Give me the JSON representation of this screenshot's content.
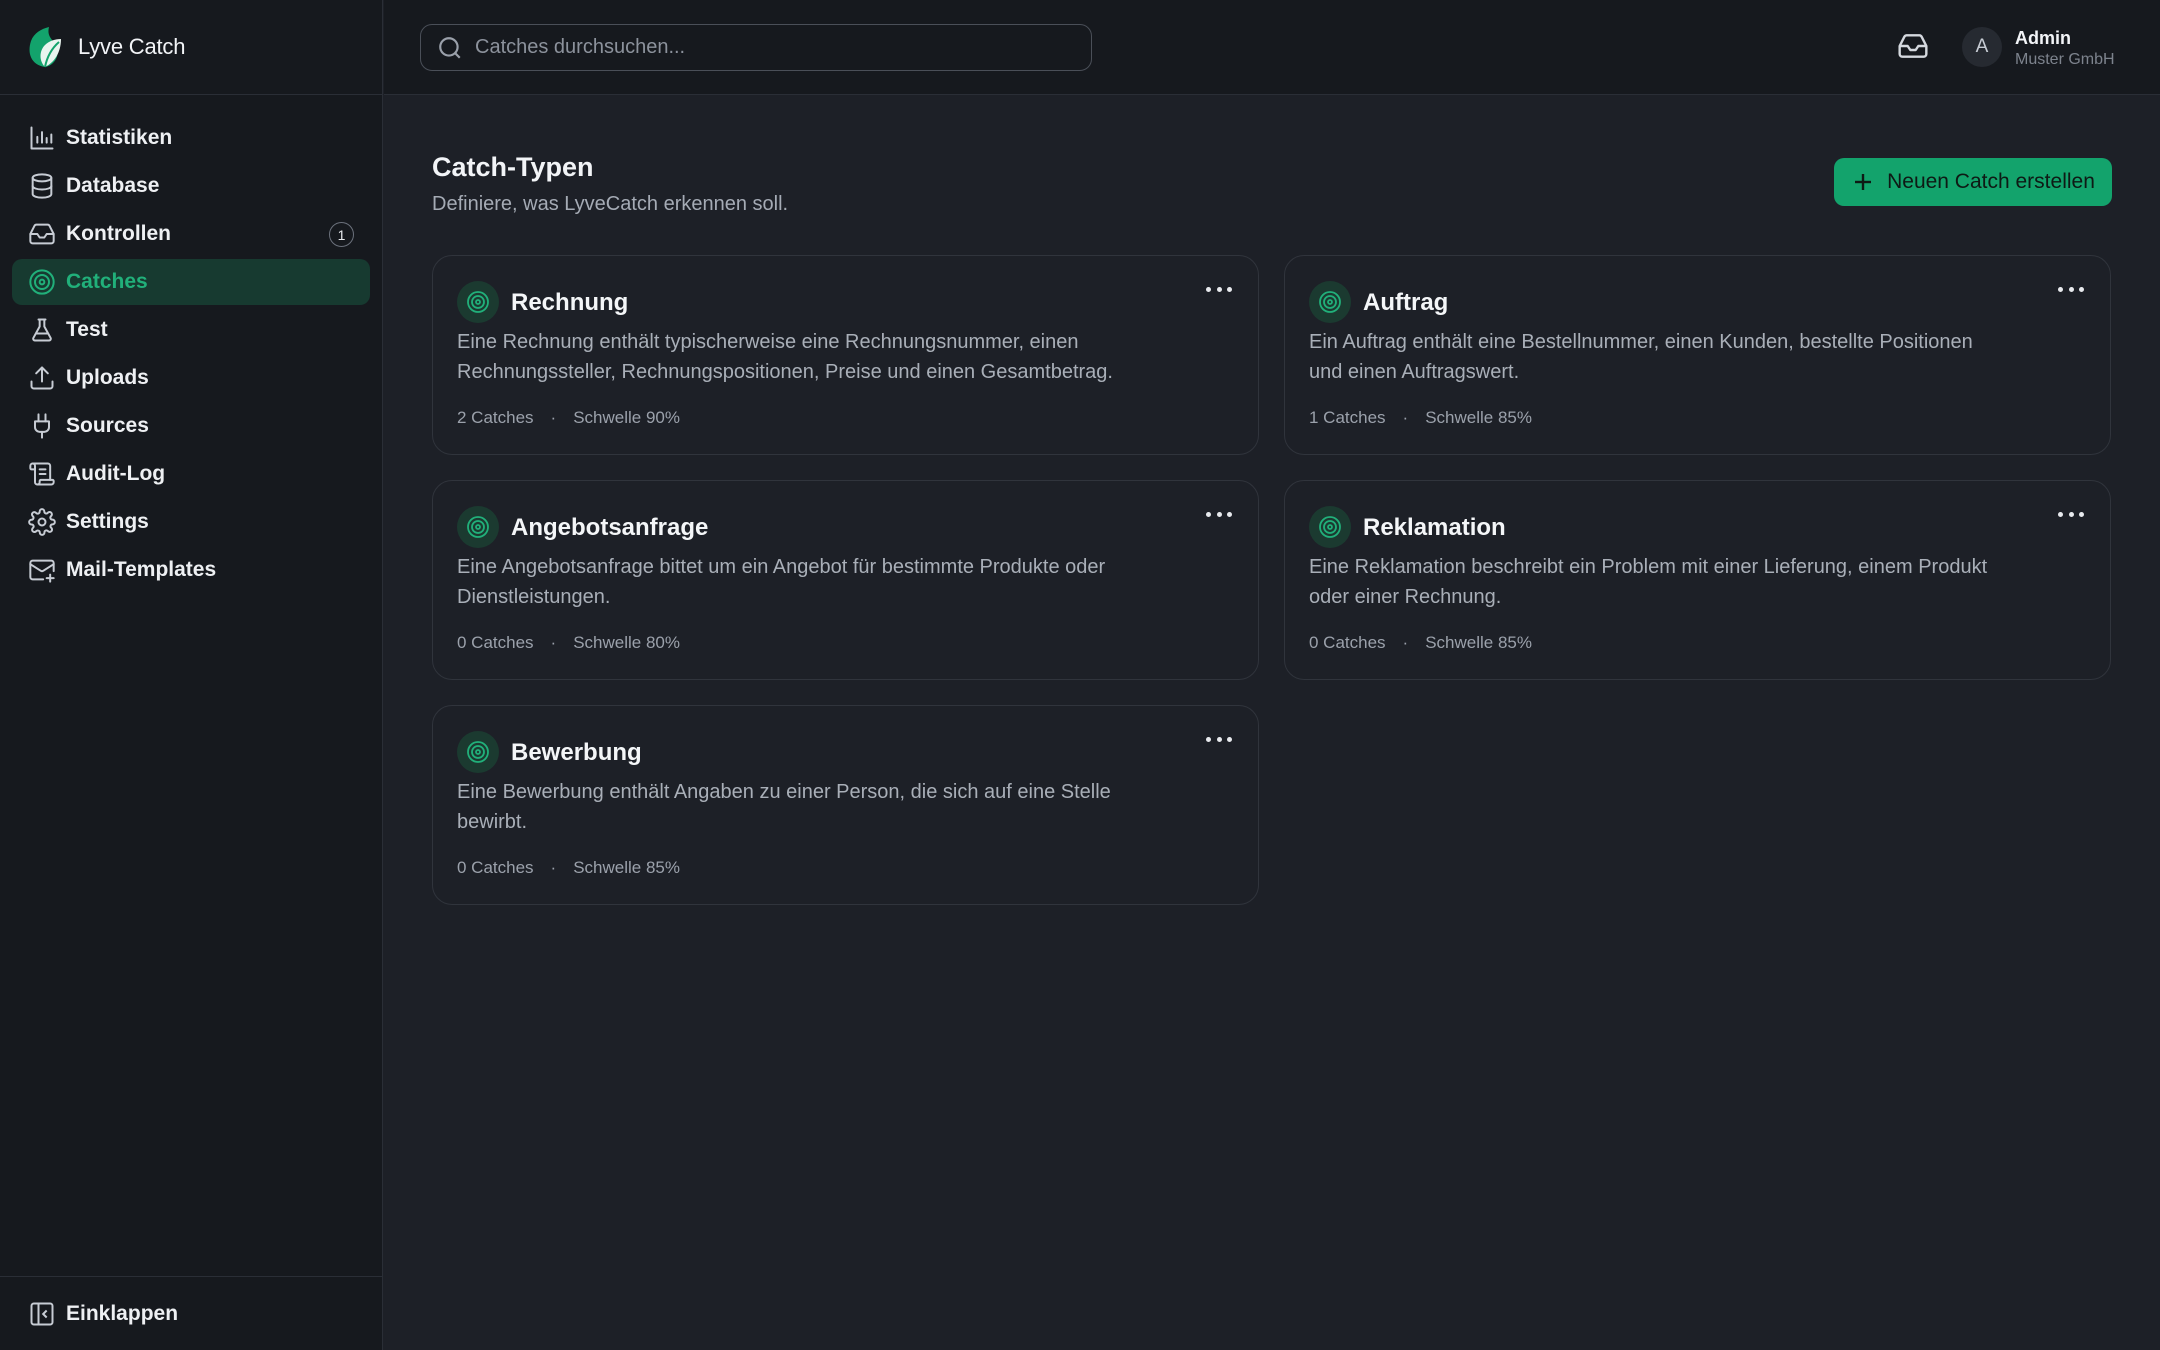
{
  "brand": {
    "name": "Lyve Catch"
  },
  "colors": {
    "accent": "#13a36c",
    "accent_text": "#21b07a",
    "sidebar_bg": "#16191e",
    "main_bg": "#1d2027"
  },
  "sidebar": {
    "items": [
      {
        "label": "Statistiken",
        "icon": "bar-chart-icon"
      },
      {
        "label": "Database",
        "icon": "database-icon"
      },
      {
        "label": "Kontrollen",
        "icon": "inbox-icon",
        "badge": "1"
      },
      {
        "label": "Catches",
        "icon": "target-icon",
        "active": true
      },
      {
        "label": "Test",
        "icon": "flask-icon"
      },
      {
        "label": "Uploads",
        "icon": "upload-icon"
      },
      {
        "label": "Sources",
        "icon": "plug-icon"
      },
      {
        "label": "Audit-Log",
        "icon": "scroll-icon"
      },
      {
        "label": "Settings",
        "icon": "gear-icon"
      },
      {
        "label": "Mail-Templates",
        "icon": "mail-plus-icon"
      }
    ],
    "collapse_label": "Einklappen"
  },
  "header": {
    "search_placeholder": "Catches durchsuchen...",
    "user": {
      "initial": "A",
      "name": "Admin",
      "org": "Muster GmbH"
    }
  },
  "main": {
    "title": "Catch-Typen",
    "subtitle": "Definiere, was LyveCatch erkennen soll.",
    "create_button": "Neuen Catch erstellen",
    "cards": [
      {
        "title": "Rechnung",
        "description": "Eine Rechnung enthält typischerweise eine Rechnungsnummer, einen Rechnungssteller, Rechnungspositionen, Preise und einen Gesamtbetrag.",
        "count": "2 Catches",
        "threshold": "Schwelle 90%"
      },
      {
        "title": "Auftrag",
        "description": "Ein Auftrag enthält eine Bestellnummer, einen Kunden, bestellte Positionen und einen Auftragswert.",
        "count": "1 Catches",
        "threshold": "Schwelle 85%"
      },
      {
        "title": "Angebotsanfrage",
        "description": "Eine Angebotsanfrage bittet um ein Angebot für bestimmte Produkte oder Dienstleistungen.",
        "count": "0 Catches",
        "threshold": "Schwelle 80%"
      },
      {
        "title": "Reklamation",
        "description": "Eine Reklamation beschreibt ein Problem mit einer Lieferung, einem Produkt oder einer Rechnung.",
        "count": "0 Catches",
        "threshold": "Schwelle 85%"
      },
      {
        "title": "Bewerbung",
        "description": "Eine Bewerbung enthält Angaben zu einer Person, die sich auf eine Stelle bewirbt.",
        "count": "0 Catches",
        "threshold": "Schwelle 85%"
      }
    ],
    "meta_separator": "·"
  }
}
